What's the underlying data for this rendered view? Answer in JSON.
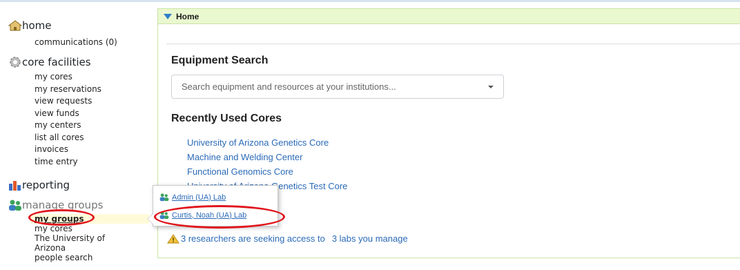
{
  "sidebar": {
    "home": {
      "label": "home",
      "items": [
        "communications (0)"
      ]
    },
    "core_facilities": {
      "label": "core facilities",
      "items": [
        "my cores",
        "my reservations",
        "view requests",
        "view funds",
        "my centers",
        "list all cores",
        "invoices",
        "time entry"
      ]
    },
    "reporting": {
      "label": "reporting"
    },
    "manage_groups": {
      "label": "manage groups",
      "items": [
        "my groups",
        "my cores",
        "The University of Arizona",
        "people search"
      ]
    }
  },
  "panel": {
    "header": "Home",
    "equipment_search": {
      "title": "Equipment Search",
      "placeholder": "Search equipment and resources at your institutions..."
    },
    "recent": {
      "title": "Recently Used Cores",
      "items": [
        "University of Arizona Genetics Core",
        "Machine and Welding Center",
        "Functional Genomics Core",
        "University of Arizona Genetics Test Core"
      ]
    },
    "access_notice": {
      "text": "3 researchers are seeking access to",
      "link": "3 labs you manage"
    }
  },
  "popup": {
    "items": [
      "Admin (UA) Lab",
      "Curtis, Noah (UA) Lab"
    ]
  },
  "colors": {
    "link": "#2a6ab8",
    "header_bg": "#eaf8d0",
    "annotation": "#e0161d",
    "active_bg": "#fffbd9"
  }
}
